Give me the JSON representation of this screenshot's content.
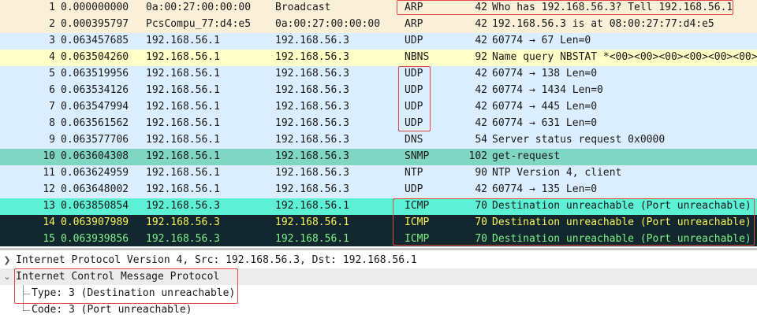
{
  "packets": [
    {
      "no": "1",
      "time": "0.000000000",
      "src": "0a:00:27:00:00:00",
      "dst": "Broadcast",
      "proto": "ARP",
      "len": "42",
      "info": "Who has 192.168.56.3? Tell 192.168.56.1",
      "bg": "#faf0d7",
      "fg": "#1a1a1a"
    },
    {
      "no": "2",
      "time": "0.000395797",
      "src": "PcsCompu_77:d4:e5",
      "dst": "0a:00:27:00:00:00",
      "proto": "ARP",
      "len": "42",
      "info": "192.168.56.3 is at 08:00:27:77:d4:e5",
      "bg": "#faf0d7",
      "fg": "#1a1a1a"
    },
    {
      "no": "3",
      "time": "0.063457685",
      "src": "192.168.56.1",
      "dst": "192.168.56.3",
      "proto": "UDP",
      "len": "42",
      "info": "60774 → 67 Len=0",
      "bg": "#daeeff",
      "fg": "#1a1a1a"
    },
    {
      "no": "4",
      "time": "0.063504260",
      "src": "192.168.56.1",
      "dst": "192.168.56.3",
      "proto": "NBNS",
      "len": "92",
      "info": "Name query NBSTAT *<00><00><00><00><00><00>",
      "bg": "#ffffc8",
      "fg": "#1a1a1a"
    },
    {
      "no": "5",
      "time": "0.063519956",
      "src": "192.168.56.1",
      "dst": "192.168.56.3",
      "proto": "UDP",
      "len": "42",
      "info": "60774 → 138 Len=0",
      "bg": "#daeeff",
      "fg": "#1a1a1a"
    },
    {
      "no": "6",
      "time": "0.063534126",
      "src": "192.168.56.1",
      "dst": "192.168.56.3",
      "proto": "UDP",
      "len": "42",
      "info": "60774 → 1434 Len=0",
      "bg": "#daeeff",
      "fg": "#1a1a1a"
    },
    {
      "no": "7",
      "time": "0.063547994",
      "src": "192.168.56.1",
      "dst": "192.168.56.3",
      "proto": "UDP",
      "len": "42",
      "info": "60774 → 445 Len=0",
      "bg": "#daeeff",
      "fg": "#1a1a1a"
    },
    {
      "no": "8",
      "time": "0.063561562",
      "src": "192.168.56.1",
      "dst": "192.168.56.3",
      "proto": "UDP",
      "len": "42",
      "info": "60774 → 631 Len=0",
      "bg": "#daeeff",
      "fg": "#1a1a1a"
    },
    {
      "no": "9",
      "time": "0.063577706",
      "src": "192.168.56.1",
      "dst": "192.168.56.3",
      "proto": "DNS",
      "len": "54",
      "info": "Server status request 0x0000",
      "bg": "#daeeff",
      "fg": "#1a1a1a"
    },
    {
      "no": "10",
      "time": "0.063604308",
      "src": "192.168.56.1",
      "dst": "192.168.56.3",
      "proto": "SNMP",
      "len": "102",
      "info": "get-request",
      "bg": "#7fd6c2",
      "fg": "#1a1a1a"
    },
    {
      "no": "11",
      "time": "0.063624959",
      "src": "192.168.56.1",
      "dst": "192.168.56.3",
      "proto": "NTP",
      "len": "90",
      "info": "NTP Version 4, client",
      "bg": "#daeeff",
      "fg": "#1a1a1a"
    },
    {
      "no": "12",
      "time": "0.063648002",
      "src": "192.168.56.1",
      "dst": "192.168.56.3",
      "proto": "UDP",
      "len": "42",
      "info": "60774 → 135 Len=0",
      "bg": "#daeeff",
      "fg": "#1a1a1a"
    },
    {
      "no": "13",
      "time": "0.063850854",
      "src": "192.168.56.3",
      "dst": "192.168.56.1",
      "proto": "ICMP",
      "len": "70",
      "info": "Destination unreachable (Port unreachable)",
      "bg": "#5cf0d4",
      "fg": "#1a1a1a"
    },
    {
      "no": "14",
      "time": "0.063907989",
      "src": "192.168.56.3",
      "dst": "192.168.56.1",
      "proto": "ICMP",
      "len": "70",
      "info": "Destination unreachable (Port unreachable)",
      "bg": "#12272e",
      "fg": "#f7f35a"
    },
    {
      "no": "15",
      "time": "0.063939856",
      "src": "192.168.56.3",
      "dst": "192.168.56.1",
      "proto": "ICMP",
      "len": "70",
      "info": "Destination unreachable (Port unreachable)",
      "bg": "#12272e",
      "fg": "#7cf28a"
    }
  ],
  "details": {
    "ip_layer": "Internet Protocol Version 4, Src: 192.168.56.3, Dst: 192.168.56.1",
    "icmp_layer": "Internet Control Message Protocol",
    "icmp_type": "Type: 3 (Destination unreachable)",
    "icmp_code": "Code: 3 (Port unreachable)"
  },
  "colors": {
    "highlight_box": "#e04848",
    "details_header_bg": "#ececec"
  }
}
